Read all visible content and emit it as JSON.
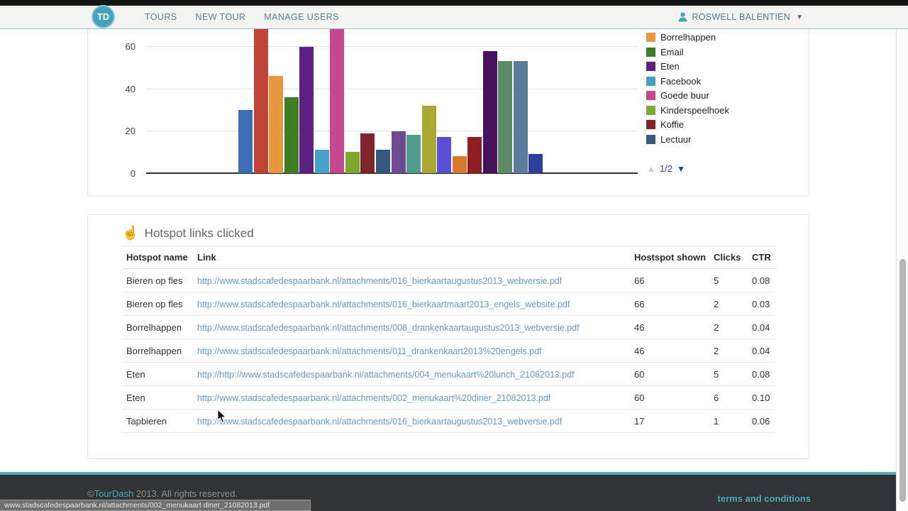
{
  "topbar": {
    "logo": "TD",
    "items": [
      {
        "label": "TOURS"
      },
      {
        "label": "NEW TOUR"
      },
      {
        "label": "MANAGE USERS"
      }
    ],
    "user": {
      "name": "ROSWELL BALENTIEN"
    }
  },
  "chart_data": {
    "type": "bar",
    "title": "",
    "xlabel": "",
    "ylabel": "",
    "y_ticks": [
      "0",
      "20",
      "40",
      "60"
    ],
    "ylim": [
      0,
      68
    ],
    "grid": true,
    "note_top_cropped": true,
    "series": [
      {
        "name": "",
        "color": "#3d6db5",
        "value": 30
      },
      {
        "name": "",
        "color": "#bf4437",
        "value": 70,
        "cropped": true
      },
      {
        "name": "Borrelhappen",
        "color": "#e8973d",
        "value": 46
      },
      {
        "name": "Email",
        "color": "#3f7d23",
        "value": 36
      },
      {
        "name": "Eten",
        "color": "#5c1f82",
        "value": 60
      },
      {
        "name": "Facebook",
        "color": "#45a0c6",
        "value": 11
      },
      {
        "name": "Goede buur",
        "color": "#c6488c",
        "value": 70,
        "cropped": true
      },
      {
        "name": "Kinderspeelhoek",
        "color": "#7daa2d",
        "value": 10
      },
      {
        "name": "Koffie",
        "color": "#7d262b",
        "value": 19
      },
      {
        "name": "Lectuur",
        "color": "#36587d",
        "value": 11
      },
      {
        "name": "",
        "color": "#6e4a91",
        "value": 20
      },
      {
        "name": "",
        "color": "#4f9e8c",
        "value": 18
      },
      {
        "name": "",
        "color": "#a8a832",
        "value": 32
      },
      {
        "name": "",
        "color": "#5a50d4",
        "value": 17
      },
      {
        "name": "",
        "color": "#d8782f",
        "value": 8
      },
      {
        "name": "",
        "color": "#8f1f23",
        "value": 17
      },
      {
        "name": "",
        "color": "#49125f",
        "value": 58
      },
      {
        "name": "",
        "color": "#5c8a66",
        "value": 53
      },
      {
        "name": "",
        "color": "#5c7a99",
        "value": 53
      },
      {
        "name": "",
        "color": "#2f3f9e",
        "value": 9
      }
    ],
    "legend": {
      "position": "right",
      "items": [
        {
          "label": "Borrelhappen",
          "color": "#e8973d"
        },
        {
          "label": "Email",
          "color": "#3f7d23"
        },
        {
          "label": "Eten",
          "color": "#5c1f82"
        },
        {
          "label": "Facebook",
          "color": "#45a0c6"
        },
        {
          "label": "Goede buur",
          "color": "#c6488c"
        },
        {
          "label": "Kinderspeelhoek",
          "color": "#7daa2d"
        },
        {
          "label": "Koffie",
          "color": "#7d262b"
        },
        {
          "label": "Lectuur",
          "color": "#36587d"
        }
      ],
      "page": "1/2"
    }
  },
  "table_card": {
    "title": "Hotspot links clicked",
    "columns": [
      "Hotspot name",
      "Link",
      "Hostspot shown",
      "Clicks",
      "CTR"
    ],
    "rows": [
      {
        "name": "Bieren op fles",
        "link": "http://www.stadscafedespaarbank.nl/attachments/016_bierkaartaugustus2013_webversie.pdf",
        "shown": "66",
        "clicks": "5",
        "ctr": "0.08"
      },
      {
        "name": "Bieren op fles",
        "link": "http://www.stadscafedespaarbank.nl/attachments/016_bierkaartmaart2013_engels_website.pdf",
        "shown": "66",
        "clicks": "2",
        "ctr": "0.03"
      },
      {
        "name": "Borrelhappen",
        "link": "http://www.stadscafedespaarbank.nl/attachments/008_drankenkaartaugustus2013_webversie.pdf",
        "shown": "46",
        "clicks": "2",
        "ctr": "0.04"
      },
      {
        "name": "Borrelhappen",
        "link": "http://www.stadscafedespaarbank.nl/attachments/011_drankenkaart2013%20engels.pdf",
        "shown": "46",
        "clicks": "2",
        "ctr": "0.04"
      },
      {
        "name": "Eten",
        "link": "http://http://www.stadscafedespaarbank.nl/attachments/004_menukaart%20lunch_21082013.pdf",
        "shown": "60",
        "clicks": "5",
        "ctr": "0.08"
      },
      {
        "name": "Eten",
        "link": "http://www.stadscafedespaarbank.nl/attachments/002_menukaart%20diner_21082013.pdf",
        "shown": "60",
        "clicks": "6",
        "ctr": "0.10"
      },
      {
        "name": "Tapbieren",
        "link": "http://www.stadscafedespaarbank.nl/attachments/016_bierkaartaugustus2013_webversie.pdf",
        "shown": "17",
        "clicks": "1",
        "ctr": "0.06"
      }
    ]
  },
  "footer": {
    "copyright_prefix": "©",
    "brand": "TourDash",
    "copyright_rest": " 2013. All rights reserved.",
    "terms_label": "terms and conditions"
  },
  "statusbar": {
    "url": "www.stadscafedespaarbank.nl/attachments/002_menukaart diner_21082013.pdf"
  },
  "colors": {
    "accent_teal": "#45a3b9",
    "link_blue": "#6699cc",
    "footer_bg": "#323335"
  }
}
